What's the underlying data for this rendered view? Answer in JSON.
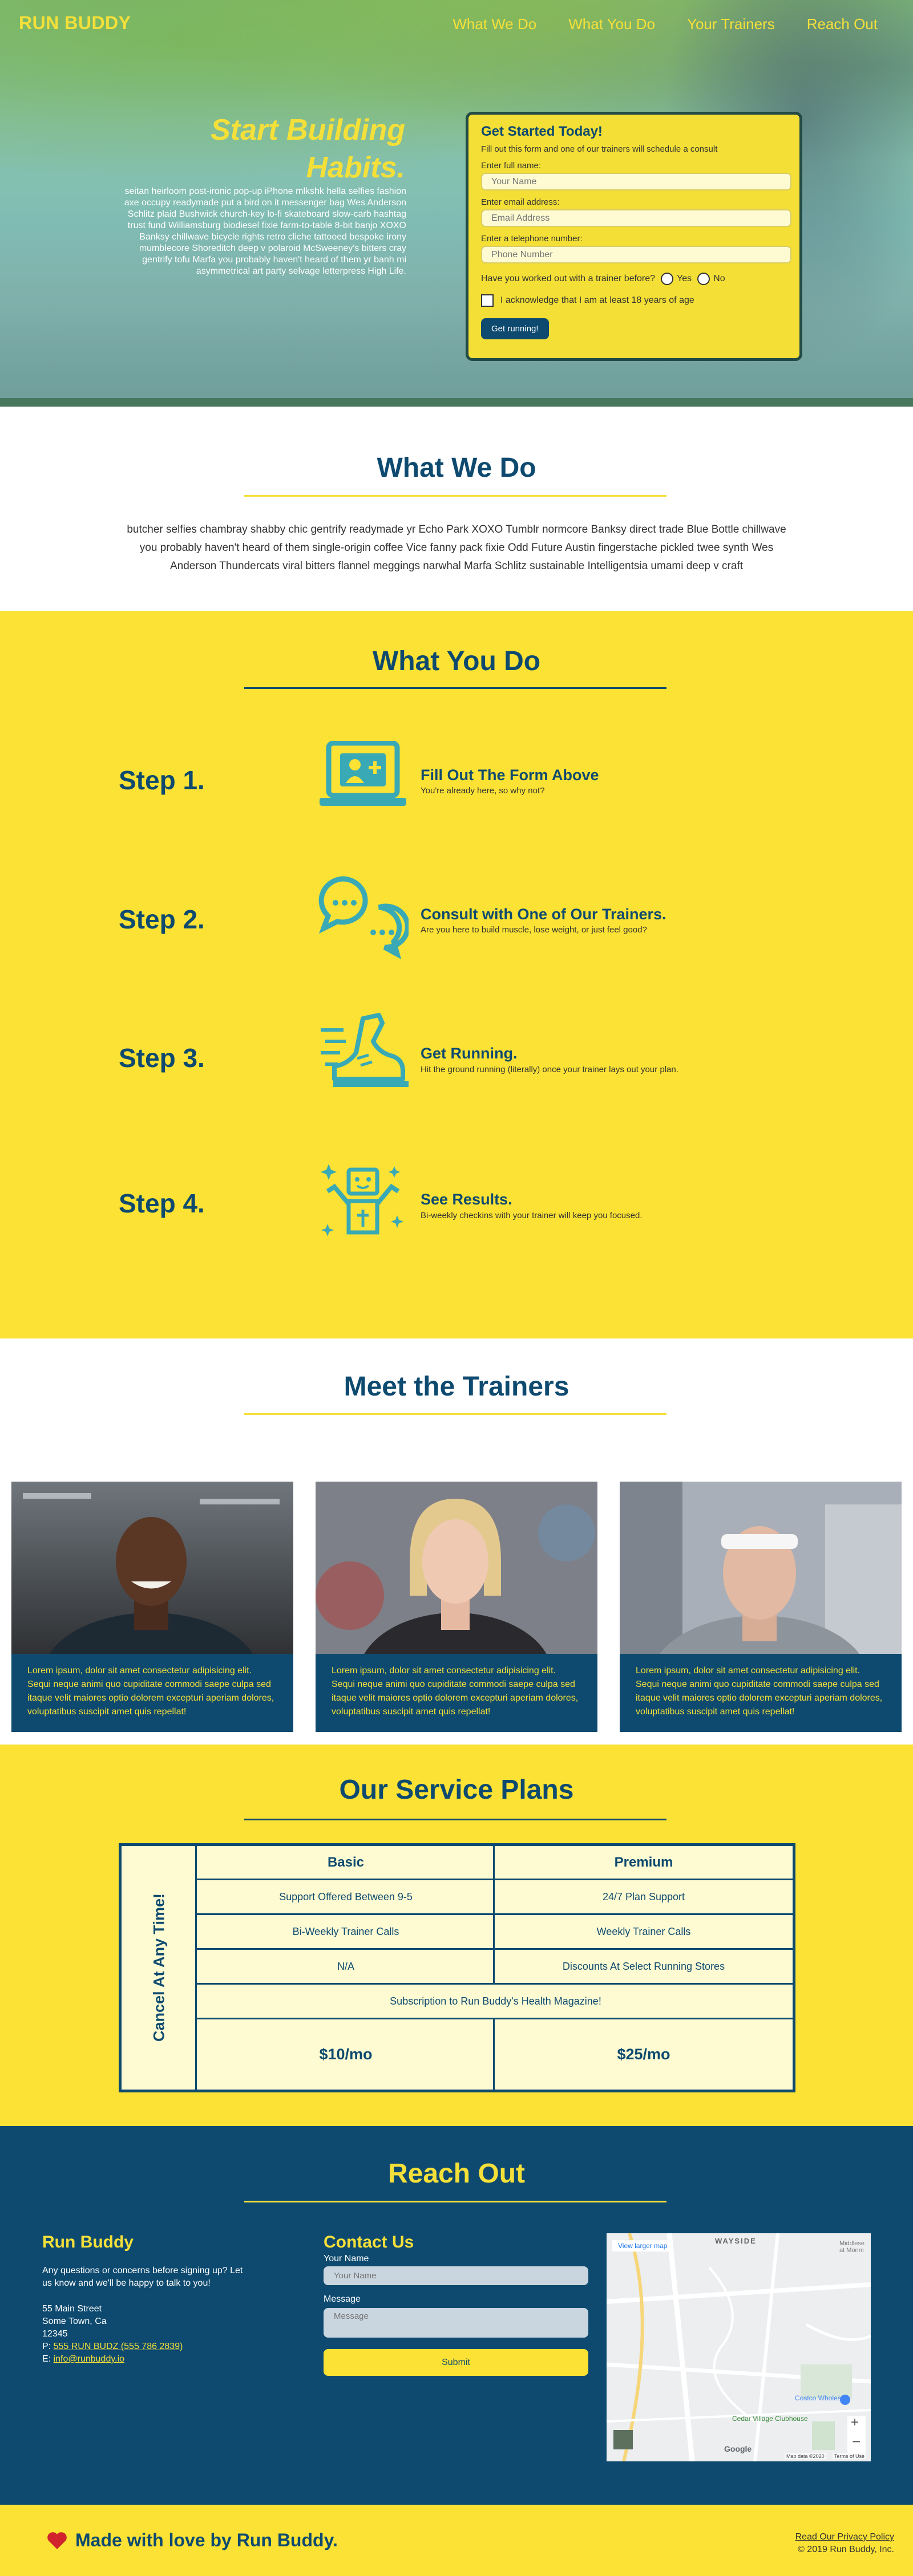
{
  "header": {
    "logo": "RUN BUDDY",
    "nav": [
      "What We Do",
      "What You Do",
      "Your Trainers",
      "Reach Out"
    ]
  },
  "hero": {
    "title_line1": "Start Building",
    "title_line2": "Habits.",
    "text": "seitan heirloom post-ironic pop-up iPhone mlkshk hella selfies fashion axe occupy readymade put a bird on it messenger bag Wes Anderson Schlitz plaid Bushwick church-key lo-fi skateboard slow-carb hashtag trust fund Williamsburg biodiesel fixie farm-to-table 8-bit banjo XOXO Banksy chillwave bicycle rights retro cliche tattooed bespoke irony mumblecore Shoreditch deep v polaroid McSweeney's bitters cray gentrify tofu Marfa you probably haven't heard of them yr banh mi asymmetrical art party selvage letterpress High Life.",
    "form": {
      "title": "Get Started Today!",
      "subtitle": "Fill out this form and one of our trainers will schedule a consult",
      "name_label": "Enter full name:",
      "name_placeholder": "Your Name",
      "email_label": "Enter email address:",
      "email_placeholder": "Email Address",
      "phone_label": "Enter a telephone number:",
      "phone_placeholder": "Phone Number",
      "radio_question": "Have you worked out with a trainer before?",
      "radio_yes": "Yes",
      "radio_no": "No",
      "checkbox_label": "I acknowledge that I am at least 18 years of age",
      "submit_label": "Get running!"
    }
  },
  "what_we_do": {
    "title": "What We Do",
    "text": "butcher selfies chambray shabby chic gentrify readymade yr Echo Park XOXO Tumblr normcore Banksy direct trade Blue Bottle chillwave you probably haven't heard of them single-origin coffee Vice fanny pack fixie Odd Future Austin fingerstache pickled twee synth Wes Anderson Thundercats viral bitters flannel meggings narwhal Marfa Schlitz sustainable Intelligentsia umami deep v craft"
  },
  "what_you_do": {
    "title": "What You Do",
    "steps": [
      {
        "label": "Step 1.",
        "title": "Fill Out The Form Above",
        "desc": "You're already here, so why not?",
        "icon": "laptop-user-icon"
      },
      {
        "label": "Step 2.",
        "title": "Consult with One of Our Trainers.",
        "desc": "Are you here to build muscle, lose weight, or just feel good?",
        "icon": "chat-bubbles-icon"
      },
      {
        "label": "Step 3.",
        "title": "Get Running.",
        "desc": "Hit the ground running (literally) once your trainer lays out your plan.",
        "icon": "running-shoe-icon"
      },
      {
        "label": "Step 4.",
        "title": "See Results.",
        "desc": "Bi-weekly checkins with your trainer will keep you focused.",
        "icon": "strong-person-icon"
      }
    ]
  },
  "trainers": {
    "title": "Meet the Trainers",
    "bio": "Lorem ipsum, dolor sit amet consectetur adipisicing elit. Sequi neque animi quo cupiditate commodi saepe culpa sed itaque velit maiores optio dolorem excepturi aperiam dolores, voluptatibus suscipit amet quis repellat!"
  },
  "plans": {
    "title": "Our Service Plans",
    "side_label": "Cancel At Any Time!",
    "basic": "Basic",
    "premium": "Premium",
    "rows": [
      [
        "Support Offered Between 9-5",
        "24/7 Plan Support"
      ],
      [
        "Bi-Weekly Trainer Calls",
        "Weekly Trainer Calls"
      ],
      [
        "N/A",
        "Discounts At Select Running Stores"
      ]
    ],
    "shared_row": "Subscription to Run Buddy's Health Magazine!",
    "basic_price": "$10/mo",
    "premium_price": "$25/mo"
  },
  "reach_out": {
    "title": "Reach Out",
    "brand_title": "Run Buddy",
    "brand_text": "Any questions or concerns before signing up? Let us know and we'll be happy to talk to you!",
    "address1": "55 Main Street",
    "address2": "Some Town, Ca",
    "address3": "12345",
    "phone_prefix": "P:",
    "phone": "555 RUN BUDZ (555 786 2839)",
    "email_prefix": "E:",
    "email": "info@runbuddy.io",
    "contact_title": "Contact Us",
    "name_label": "Your Name",
    "name_placeholder": "Your Name",
    "message_label": "Message",
    "message_placeholder": "Message",
    "submit_label": "Submit",
    "map": {
      "view_larger": "View larger map",
      "label_wayside": "WAYSIDE",
      "label_middle": "Middlese at Monm",
      "label_costco": "Costco Wholesale",
      "label_cedar": "Cedar Village Clubhouse",
      "google": "Google",
      "map_data": "Map data ©2020",
      "terms": "Terms of Use"
    }
  },
  "footer": {
    "made_with": "Made with love by Run Buddy.",
    "privacy": "Read Our Privacy Policy",
    "copyright": "© 2019 Run Buddy, Inc."
  },
  "colors": {
    "brand_blue": "#0e4a6f",
    "brand_yellow": "#fbe234",
    "icon_teal": "#39a9b5",
    "heart_red": "#d0232b"
  }
}
